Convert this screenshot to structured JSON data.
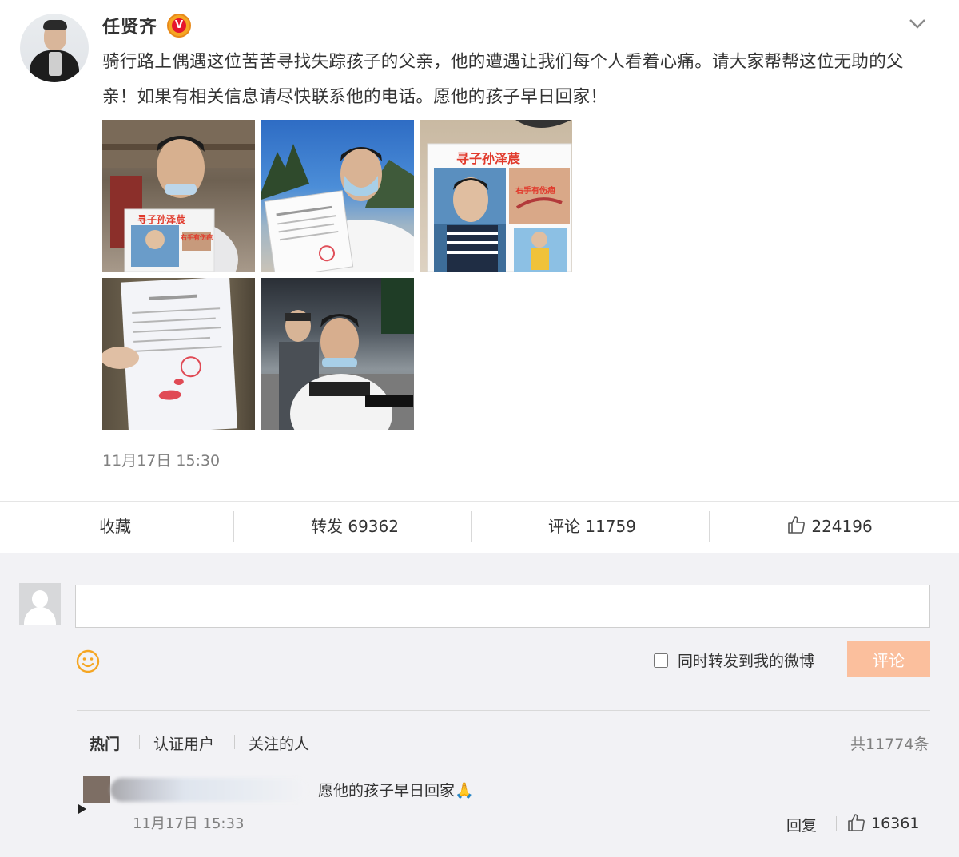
{
  "post": {
    "author_name": "任贤齐",
    "verified_mark": "V",
    "text": "骑行路上偶遇这位苦苦寻找失踪孩子的父亲，他的遭遇让我们每个人看着心痛。请大家帮帮这位无助的父亲！如果有相关信息请尽快联系他的电话。愿他的孩子早日回家！",
    "time": "11月17日 15:30",
    "photos": [
      {
        "poster_title": "寻子孙泽莀",
        "poster_note": "右手有伤疤"
      },
      {},
      {
        "poster_title": "寻子孙泽莀",
        "poster_note": "右手有伤疤"
      },
      {},
      {}
    ]
  },
  "actions": {
    "favorite": "收藏",
    "repost": "转发 69362",
    "comment": "评论 11759",
    "like_count": "224196"
  },
  "compose": {
    "placeholder": "",
    "share_label": "同时转发到我的微博",
    "submit_label": "评论"
  },
  "filters": {
    "tabs": [
      "热门",
      "认证用户",
      "关注的人"
    ],
    "total": "共11774条"
  },
  "comments": [
    {
      "text": "愿他的孩子早日回家🙏",
      "time": "11月17日 15:33",
      "reply_label": "回复",
      "like_count": "16361"
    }
  ],
  "icons": {
    "verified": "verified-badge-icon",
    "menu": "chevron-down-icon",
    "like": "thumbs-up-icon",
    "emoji": "smiley-icon",
    "default_avatar": "default-avatar-icon"
  },
  "colors": {
    "accent": "#fa7d3c",
    "submit_disabled": "#fbbf9d",
    "verified": "#f5a623"
  }
}
